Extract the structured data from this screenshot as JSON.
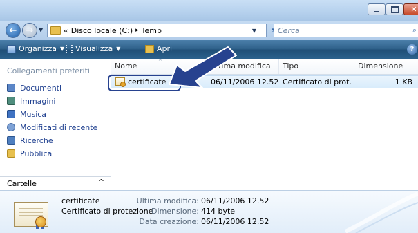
{
  "window": {
    "caption_buttons": {
      "minimize_icon": "minimize-icon",
      "maximize_icon": "maximize-icon",
      "close_icon": "close-icon"
    }
  },
  "address_bar": {
    "overflow": "«",
    "crumbs": [
      "Disco locale (C:)",
      "Temp"
    ],
    "separator": "▸",
    "search_placeholder": "Cerca"
  },
  "toolbar": {
    "organize": "Organizza",
    "view": "Visualizza",
    "open": "Apri",
    "help": "?"
  },
  "nav_pane": {
    "header": "Collegamenti preferiti",
    "items": [
      {
        "label": "Documenti",
        "icon": "documents-icon",
        "color": "#5b86c7"
      },
      {
        "label": "Immagini",
        "icon": "pictures-icon",
        "color": "#4f8e7e"
      },
      {
        "label": "Musica",
        "icon": "music-icon",
        "color": "#3f72c2"
      },
      {
        "label": "Modificati di recente",
        "icon": "recent-icon",
        "color": "#7ea2d6"
      },
      {
        "label": "Ricerche",
        "icon": "searches-icon",
        "color": "#4f7fbf"
      },
      {
        "label": "Pubblica",
        "icon": "public-folder-icon",
        "color": "#e7c04e"
      }
    ],
    "folders_label": "Cartelle",
    "folders_caret": "^"
  },
  "file_list": {
    "columns": [
      "Nome",
      "Ultima modifica",
      "Tipo",
      "Dimensione"
    ],
    "sort_indicator": "^",
    "rows": [
      {
        "name": "certificate",
        "modified": "06/11/2006 12.52",
        "type": "Certificato di prot...",
        "size": "1 KB"
      }
    ]
  },
  "details": {
    "name": "certificate",
    "type": "Certificato di protezione",
    "modified_label": "Ultima modifica:",
    "modified_value": "06/11/2006 12.52",
    "size_label": "Dimensione:",
    "size_value": "414 byte",
    "created_label": "Data creazione:",
    "created_value": "06/11/2006 12.52"
  },
  "colors": {
    "accent": "#1e3f8f",
    "toolbar": "#2d5f88",
    "selection": "#d9ecfb",
    "callout": "#27428f"
  }
}
